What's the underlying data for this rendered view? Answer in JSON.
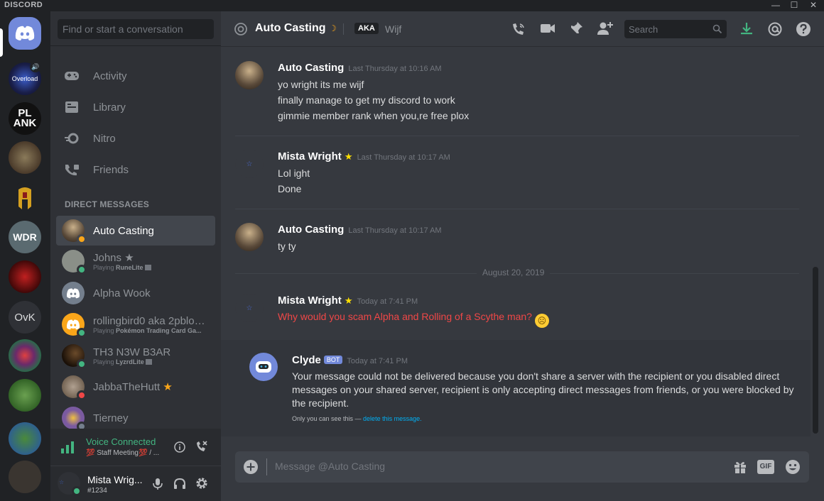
{
  "window": {
    "brand": "DISCORD"
  },
  "servers": [
    {
      "label": "Overload"
    },
    {
      "label": "PL ANK"
    },
    {
      "label": ""
    },
    {
      "label": ""
    },
    {
      "label": "WDR"
    },
    {
      "label": ""
    },
    {
      "label": "OvK"
    },
    {
      "label": ""
    },
    {
      "label": ""
    },
    {
      "label": ""
    },
    {
      "label": ""
    }
  ],
  "sidebar": {
    "search_placeholder": "Find or start a conversation",
    "nav": [
      {
        "label": "Activity",
        "icon": "controller-icon"
      },
      {
        "label": "Library",
        "icon": "library-icon"
      },
      {
        "label": "Nitro",
        "icon": "nitro-icon"
      },
      {
        "label": "Friends",
        "icon": "friends-icon"
      }
    ],
    "dm_header": "DIRECT MESSAGES",
    "dms": [
      {
        "name": "Auto Casting",
        "sub": "",
        "active": true,
        "status": "idle",
        "color": "#5a4a3a"
      },
      {
        "name": "Johns ★",
        "sub_prefix": "Playing ",
        "sub_bold": "RuneLite",
        "status": "online",
        "color": "#8a8f88"
      },
      {
        "name": "Alpha Wook",
        "sub": "",
        "status": "none",
        "color": "#747f8d"
      },
      {
        "name": "rollingbird0 aka 2pbloa...",
        "sub_prefix": "Playing ",
        "sub_bold": "Pokémon Trading Card Ga...",
        "status": "online",
        "color": "#faa61a"
      },
      {
        "name": "TH3 N3W B3AR",
        "sub_prefix": "Playing ",
        "sub_bold": "LyzrdLite",
        "status": "online",
        "color": "#3a2a1a"
      },
      {
        "name": "JabbaTheHutt",
        "sub": "",
        "status": "dnd",
        "color": "#8a7a6a"
      },
      {
        "name": "Tierney",
        "sub": "",
        "status": "offline",
        "color": "#7a5aa0"
      }
    ],
    "voice": {
      "status": "Voice Connected",
      "channel": "💯 Staff Meeting💯 / ..."
    },
    "user": {
      "name": "Mista Wrig...",
      "discriminator": "#1234"
    }
  },
  "header": {
    "title": "Auto Casting",
    "aka_badge": "AKA",
    "aka_name": "Wijf",
    "search_placeholder": "Search"
  },
  "messages": [
    {
      "author": "Auto Casting",
      "time": "Last Thursday at 10:16 AM",
      "lines": [
        "yo wright its me wijf",
        "finally manage to get my discord to work",
        "gimmie member rank when you,re free plox"
      ]
    },
    {
      "author": "Mista Wright",
      "time": "Last Thursday at 10:17 AM",
      "lines": [
        "Lol ight",
        "Done"
      ]
    },
    {
      "author": "Auto Casting",
      "time": "Last Thursday at 10:17 AM",
      "lines": [
        "ty ty"
      ]
    },
    {
      "author": "Mista Wright",
      "time": "Today at 7:41 PM",
      "lines": [
        "Why would you scam Alpha and Rolling of a Scythe man?"
      ]
    }
  ],
  "date_divider": "August 20, 2019",
  "clyde": {
    "author": "Clyde",
    "badge": "BOT",
    "time": "Today at 7:41 PM",
    "text": "Your message could not be delivered because you don't share a server with the recipient or you disabled direct messages on your shared server, recipient is only accepting direct messages from friends, or you were blocked by the recipient.",
    "note_prefix": "Only you can see this — ",
    "note_link": "delete this message."
  },
  "composer": {
    "placeholder": "Message @Auto Casting",
    "gif_label": "GIF"
  },
  "colors": {
    "accent": "#7289da",
    "online": "#43b581",
    "idle": "#faa61a",
    "dnd": "#f04747",
    "error_text": "#f04747"
  }
}
